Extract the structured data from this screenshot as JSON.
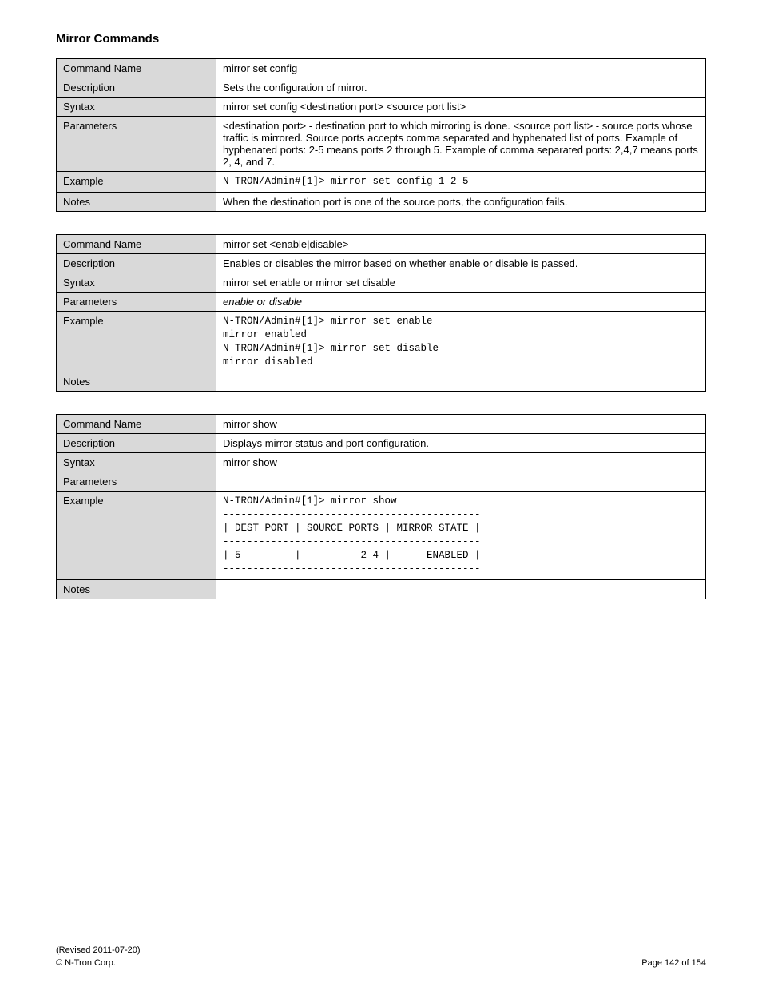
{
  "heading": "Mirror Commands",
  "table1": {
    "rows": [
      {
        "label": "Command Name",
        "value": "mirror set config"
      },
      {
        "label": "Description",
        "value": "Sets the configuration of mirror."
      },
      {
        "label": "Syntax",
        "value": "mirror set config <destination port> <source port list>"
      },
      {
        "label": "Parameters",
        "value": "<destination port> - destination port to which mirroring is done.\n<source port list> - source ports whose traffic is mirrored. Source\nports accepts comma separated and hyphenated list of ports.\nExample of hyphenated ports: 2-5 means ports 2 through 5.\nExample of comma separated ports: 2,4,7 means ports 2, 4, and 7."
      },
      {
        "label": "Example",
        "value": "N-TRON/Admin#[1]> mirror set config 1 2-5",
        "mono": true
      },
      {
        "label": "Notes",
        "value": "When the destination port is one of the source ports, the\nconfiguration fails."
      }
    ]
  },
  "table2": {
    "rows": [
      {
        "label": "Command Name",
        "value": "mirror set <enable|disable>"
      },
      {
        "label": "Description",
        "value": "Enables or disables the mirror based on whether enable or disable is\npassed."
      },
      {
        "label": "Syntax",
        "value": "mirror set enable or mirror set disable"
      },
      {
        "label": "Parameters",
        "value": "enable or disable",
        "italic": true
      },
      {
        "label": "Example",
        "value": "N-TRON/Admin#[1]> mirror set enable\nmirror enabled\nN-TRON/Admin#[1]> mirror set disable\nmirror disabled",
        "mono": true
      },
      {
        "label": "Notes",
        "value": ""
      }
    ]
  },
  "table3": {
    "rows": [
      {
        "label": "Command Name",
        "value": "mirror show"
      },
      {
        "label": "Description",
        "value": "Displays mirror status and port configuration."
      },
      {
        "label": "Syntax",
        "value": "mirror show"
      },
      {
        "label": "Parameters",
        "value": ""
      },
      {
        "label": "Example",
        "value": "N-TRON/Admin#[1]> mirror show\n-------------------------------------------\n| DEST PORT | SOURCE PORTS | MIRROR STATE |\n-------------------------------------------\n| 5         |          2-4 |      ENABLED |\n-------------------------------------------",
        "mono": true
      },
      {
        "label": "Notes",
        "value": ""
      }
    ]
  },
  "footer": {
    "rev": "(Revised 2011-07-20)",
    "page": "Page 142 of 154",
    "copy": "© N-Tron Corp."
  }
}
